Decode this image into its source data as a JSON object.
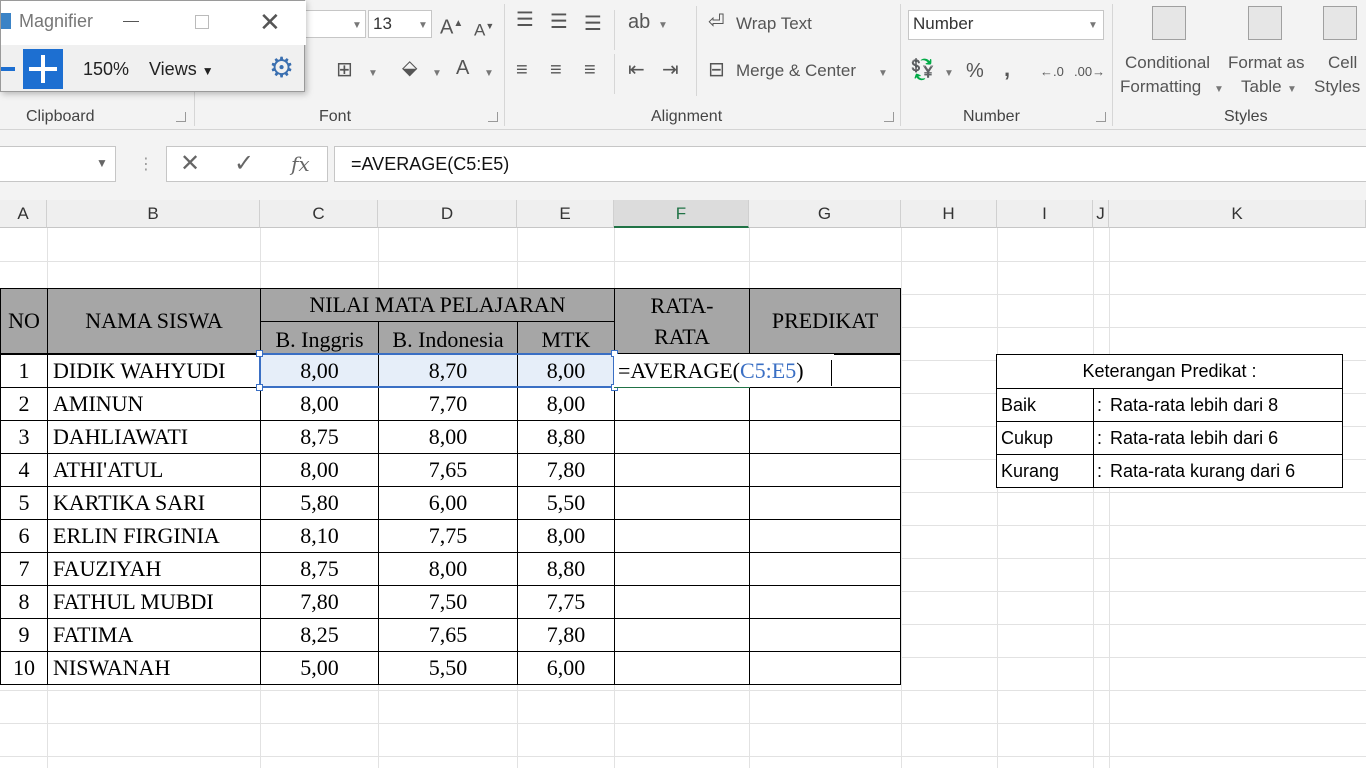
{
  "ribbon": {
    "font_size": "13",
    "number_format": "Number",
    "wrap_text": "Wrap Text",
    "merge_center": "Merge & Center",
    "percent": "%",
    "comma": ",",
    "conditional_formatting_1": "Conditional",
    "conditional_formatting_2": "Formatting",
    "format_as_table_1": "Format as",
    "format_as_table_2": "Table",
    "cell_styles_1": "Cell",
    "cell_styles_2": "Styles",
    "groups": {
      "clipboard": "Clipboard",
      "font": "Font",
      "alignment": "Alignment",
      "number": "Number",
      "styles": "Styles"
    }
  },
  "magnifier": {
    "title": "Magnifier",
    "zoom": "150%",
    "views": "Views"
  },
  "formula_bar": {
    "formula": "=AVERAGE(C5:E5)"
  },
  "columns": [
    "A",
    "B",
    "C",
    "D",
    "E",
    "F",
    "G",
    "H",
    "I",
    "J",
    "K"
  ],
  "sheet": {
    "header": {
      "no": "NO",
      "nama": "NAMA SISWA",
      "nilai": "NILAI MATA PELAJARAN",
      "inggris": "B. Inggris",
      "indonesia": "B. Indonesia",
      "mtk": "MTK",
      "rata_1": "RATA-",
      "rata_2": "RATA",
      "predikat": "PREDIKAT"
    },
    "rows": [
      {
        "no": "1",
        "nama": "DIDIK WAHYUDI",
        "inggris": "8,00",
        "indonesia": "8,70",
        "mtk": "8,00"
      },
      {
        "no": "2",
        "nama": "AMINUN",
        "inggris": "8,00",
        "indonesia": "7,70",
        "mtk": "8,00"
      },
      {
        "no": "3",
        "nama": "DAHLIAWATI",
        "inggris": "8,75",
        "indonesia": "8,00",
        "mtk": "8,80"
      },
      {
        "no": "4",
        "nama": "ATHI'ATUL",
        "inggris": "8,00",
        "indonesia": "7,65",
        "mtk": "7,80"
      },
      {
        "no": "5",
        "nama": "KARTIKA SARI",
        "inggris": "5,80",
        "indonesia": "6,00",
        "mtk": "5,50"
      },
      {
        "no": "6",
        "nama": "ERLIN FIRGINIA",
        "inggris": "8,10",
        "indonesia": "7,75",
        "mtk": "8,00"
      },
      {
        "no": "7",
        "nama": "FAUZIYAH",
        "inggris": "8,75",
        "indonesia": "8,00",
        "mtk": "8,80"
      },
      {
        "no": "8",
        "nama": "FATHUL MUBDI",
        "inggris": "7,80",
        "indonesia": "7,50",
        "mtk": "7,75"
      },
      {
        "no": "9",
        "nama": "FATIMA",
        "inggris": "8,25",
        "indonesia": "7,65",
        "mtk": "7,80"
      },
      {
        "no": "10",
        "nama": "NISWANAH",
        "inggris": "5,00",
        "indonesia": "5,50",
        "mtk": "6,00"
      }
    ],
    "editing": {
      "prefix": "=AVERAGE(",
      "ref": "C5:E5",
      "suffix": ")"
    }
  },
  "legend": {
    "title": "Keterangan Predikat :",
    "separator": ":",
    "items": [
      {
        "label": "Baik",
        "desc": "Rata-rata lebih dari 8"
      },
      {
        "label": "Cukup",
        "desc": "Rata-rata lebih dari 6"
      },
      {
        "label": "Kurang",
        "desc": "Rata-rata kurang dari 6"
      }
    ]
  }
}
